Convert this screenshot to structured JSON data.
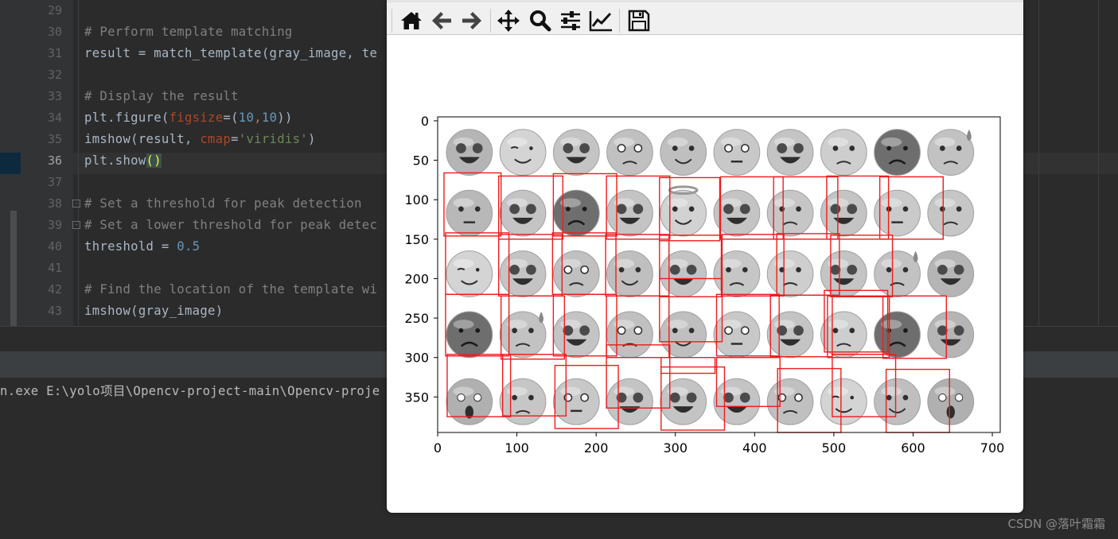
{
  "editor": {
    "lines": [
      {
        "num": "29",
        "segs": []
      },
      {
        "num": "30",
        "segs": [
          {
            "t": "# Perform template matching",
            "c": "cm"
          }
        ]
      },
      {
        "num": "31",
        "segs": [
          {
            "t": "result = match_template(gray_image, te",
            "c": ""
          }
        ]
      },
      {
        "num": "32",
        "segs": []
      },
      {
        "num": "33",
        "segs": [
          {
            "t": "# Display the result",
            "c": "cm"
          }
        ]
      },
      {
        "num": "34",
        "segs": [
          {
            "t": "plt.figure(",
            "c": ""
          },
          {
            "t": "figsize",
            "c": "par"
          },
          {
            "t": "=(",
            "c": ""
          },
          {
            "t": "10",
            "c": "num"
          },
          {
            "t": ",",
            "c": "kw"
          },
          {
            "t": "10",
            "c": "num"
          },
          {
            "t": "))",
            "c": ""
          }
        ]
      },
      {
        "num": "35",
        "segs": [
          {
            "t": "imshow(result, ",
            "c": ""
          },
          {
            "t": "cmap",
            "c": "par"
          },
          {
            "t": "=",
            "c": ""
          },
          {
            "t": "'viridis'",
            "c": "str"
          },
          {
            "t": ")",
            "c": ""
          }
        ]
      },
      {
        "num": "36",
        "segs": [
          {
            "t": "plt.show",
            "c": ""
          },
          {
            "t": "()",
            "c": "brk"
          }
        ],
        "current": true
      },
      {
        "num": "37",
        "segs": []
      },
      {
        "num": "38",
        "segs": [
          {
            "t": "# Set a threshold for peak detection",
            "c": "cm"
          }
        ],
        "fold": "-"
      },
      {
        "num": "39",
        "segs": [
          {
            "t": "# Set a lower threshold for peak detec",
            "c": "cm"
          }
        ],
        "fold": "-"
      },
      {
        "num": "40",
        "segs": [
          {
            "t": "threshold = ",
            "c": ""
          },
          {
            "t": "0.5",
            "c": "num"
          }
        ]
      },
      {
        "num": "41",
        "segs": []
      },
      {
        "num": "42",
        "segs": [
          {
            "t": "# Find the location of the template wi",
            "c": "cm"
          }
        ]
      },
      {
        "num": "43",
        "segs": [
          {
            "t": "imshow(gray_image)",
            "c": ""
          }
        ]
      }
    ]
  },
  "console": {
    "line": "n.exe E:\\yolo项目\\Opencv-project-main\\Opencv-proje"
  },
  "watermark": "CSDN @落叶霜霜",
  "toolbar": {
    "buttons": [
      {
        "name": "home-button",
        "icon": "home-icon"
      },
      {
        "name": "back-button",
        "icon": "arrow-left-icon"
      },
      {
        "name": "forward-button",
        "icon": "arrow-right-icon"
      },
      {
        "name": "pan-button",
        "icon": "move-icon"
      },
      {
        "name": "zoom-button",
        "icon": "magnifier-icon"
      },
      {
        "name": "configure-subplots-button",
        "icon": "sliders-icon"
      },
      {
        "name": "edit-axes-button",
        "icon": "line-chart-icon"
      },
      {
        "name": "save-button",
        "icon": "floppy-disk-icon"
      }
    ]
  },
  "chart_data": {
    "type": "image",
    "xlim": [
      0,
      710
    ],
    "ylim": [
      395,
      -5
    ],
    "xticks": [
      "0",
      "100",
      "200",
      "300",
      "400",
      "500",
      "600",
      "700"
    ],
    "yticks": [
      "0",
      "50",
      "100",
      "150",
      "200",
      "250",
      "300",
      "350"
    ],
    "emoji_grid": [
      [
        "star-eyes",
        "wink",
        "heart-eyes",
        "pleading",
        "zany",
        "flushed",
        "heart-eyes",
        "pensive",
        "angry",
        "anxious-sweat"
      ],
      [
        "raised-eyebrow",
        "heart-eyes",
        "angry",
        "heart-eyes",
        "halo",
        "heart-eyes",
        "bandage",
        "heart-eyes",
        "neutral",
        "bandage"
      ],
      [
        "wink",
        "heart-eyes",
        "pleading",
        "zany",
        "heart-eyes",
        "bandage",
        "pensive",
        "heart-eyes",
        "anxious-sweat",
        "star-eyes"
      ],
      [
        "angry",
        "anxious-sweat",
        "heart-eyes",
        "pleading",
        "zany",
        "flushed",
        "heart-eyes",
        "pensive",
        "angry",
        "star-eyes"
      ],
      [
        "astonished",
        "bandage",
        "flushed",
        "heart-eyes",
        "heart-eyes",
        "heart-eyes",
        "pleading",
        "wink",
        "zany",
        "astonished"
      ]
    ],
    "detections": [
      [
        8,
        66,
        80,
        146
      ],
      [
        77,
        70,
        158,
        150
      ],
      [
        146,
        67,
        226,
        146
      ],
      [
        213,
        70,
        293,
        150
      ],
      [
        280,
        72,
        356,
        152
      ],
      [
        357,
        71,
        436,
        150
      ],
      [
        424,
        71,
        505,
        150
      ],
      [
        491,
        70,
        569,
        150
      ],
      [
        558,
        71,
        638,
        150
      ],
      [
        10,
        142,
        90,
        220
      ],
      [
        77,
        144,
        157,
        222
      ],
      [
        145,
        142,
        225,
        220
      ],
      [
        212,
        144,
        292,
        222
      ],
      [
        280,
        145,
        358,
        223
      ],
      [
        359,
        144,
        437,
        222
      ],
      [
        428,
        143,
        507,
        221
      ],
      [
        496,
        145,
        574,
        223
      ],
      [
        10,
        220,
        90,
        298
      ],
      [
        80,
        222,
        160,
        302
      ],
      [
        146,
        220,
        226,
        298
      ],
      [
        213,
        222,
        292,
        300
      ],
      [
        280,
        200,
        359,
        280
      ],
      [
        352,
        220,
        431,
        298
      ],
      [
        420,
        221,
        498,
        299
      ],
      [
        488,
        215,
        568,
        293
      ],
      [
        492,
        222,
        570,
        300
      ],
      [
        562,
        222,
        642,
        301
      ],
      [
        12,
        296,
        92,
        375
      ],
      [
        82,
        296,
        162,
        374
      ],
      [
        148,
        310,
        228,
        390
      ],
      [
        213,
        284,
        293,
        364
      ],
      [
        282,
        312,
        362,
        392
      ],
      [
        352,
        300,
        432,
        362
      ],
      [
        429,
        314,
        509,
        395
      ],
      [
        498,
        296,
        578,
        375
      ],
      [
        566,
        315,
        646,
        395
      ],
      [
        282,
        300,
        350,
        320
      ]
    ]
  }
}
